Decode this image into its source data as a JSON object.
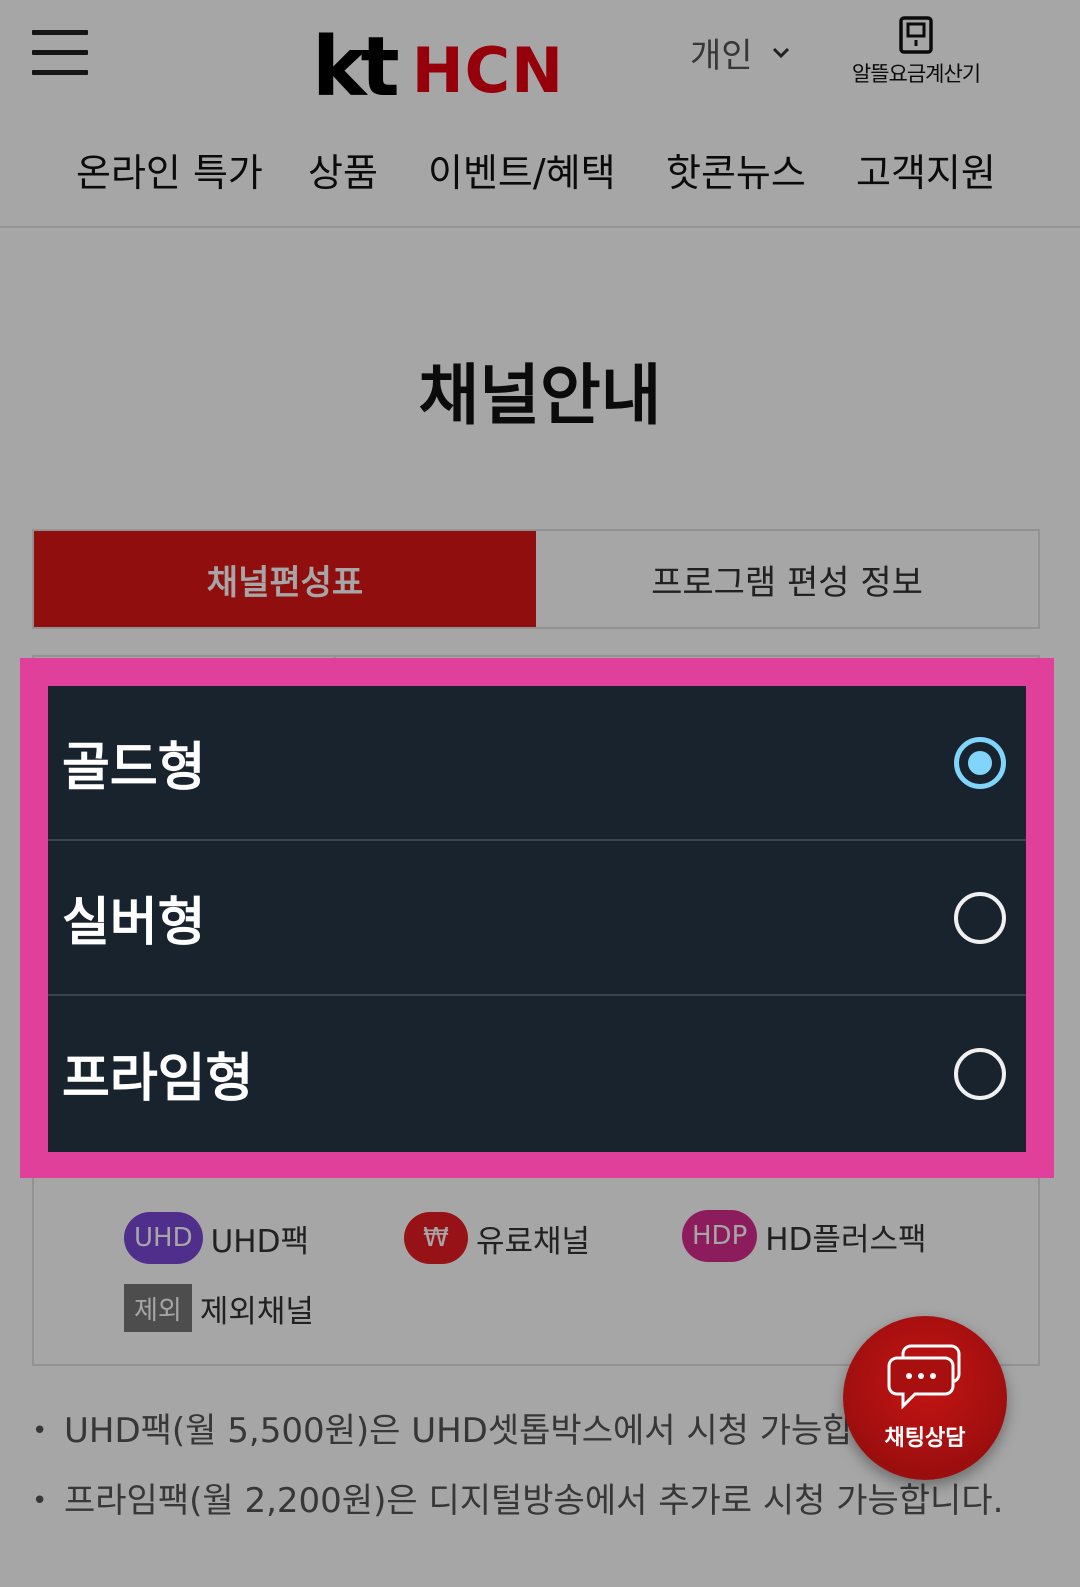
{
  "header": {
    "logo_kt": "kt",
    "logo_hcn": "HCN",
    "user_type": "개인",
    "calculator_label": "알뜰요금계산기",
    "brand_color": "#e60012"
  },
  "nav": {
    "items": [
      {
        "label": "온라인 특가"
      },
      {
        "label": "상품"
      },
      {
        "label": "이벤트/혜택"
      },
      {
        "label": "핫콘뉴스"
      },
      {
        "label": "고객지원"
      }
    ]
  },
  "page": {
    "title": "채널안내"
  },
  "tabs": [
    {
      "label": "채널편성표",
      "active": true
    },
    {
      "label": "프로그램 편성 정보",
      "active": false
    }
  ],
  "legend": {
    "items": [
      {
        "badge": "UHD",
        "label": "UHD팩",
        "color": "#7b48d8"
      },
      {
        "badge": "₩",
        "label": "유료채널",
        "color": "#e91c24"
      },
      {
        "badge": "HDP",
        "label": "HD플러스팩",
        "color": "#d92c90"
      },
      {
        "badge": "제외",
        "label": "제외채널",
        "color": "#777777"
      }
    ]
  },
  "notes": [
    "UHD팩(월 5,500원)은 UHD셋톱박스에서 시청 가능합니다.",
    "프라임팩(월 2,200원)은 디지털방송에서 추가로 시청 가능합니다."
  ],
  "modal": {
    "options": [
      {
        "label": "골드형",
        "selected": true
      },
      {
        "label": "실버형",
        "selected": false
      },
      {
        "label": "프라임형",
        "selected": false
      }
    ],
    "highlight_color": "#e0409a",
    "background_color": "#18232e",
    "selected_radio_color": "#81d4fa"
  },
  "chat": {
    "label": "채팅상담"
  }
}
